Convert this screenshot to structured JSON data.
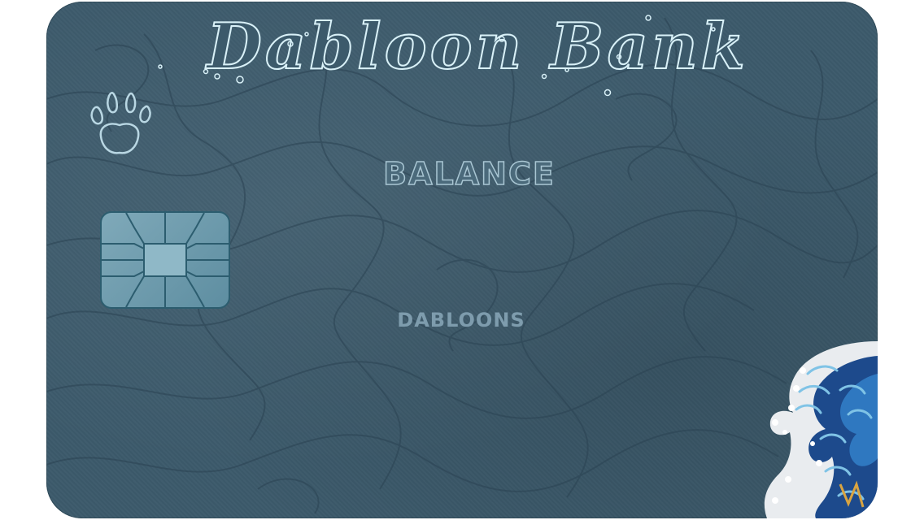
{
  "card": {
    "bank_name": "Dabloon Bank",
    "balance_label": "BALANCE",
    "currency_label": "DABLOONS"
  },
  "icons": {
    "logo": "paw-print-icon",
    "chip": "chip-icon",
    "decoration": "great-wave-illustration"
  },
  "colors": {
    "card_background": "#3c5a6b",
    "title_outline": "#d9f1f8",
    "chip": "#7fa9b9"
  }
}
